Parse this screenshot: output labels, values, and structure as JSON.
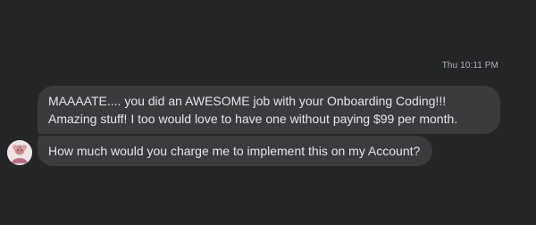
{
  "conversation": {
    "timestamp": "Thu 10:11 PM",
    "messages": [
      {
        "text": "MAAAATE.... you did an AWESOME job with your Onboarding Coding!!! Amazing stuff! I too would love to have one without paying $99 per month."
      },
      {
        "text": "How much would you charge me to implement this on my Account?"
      }
    ],
    "sender_avatar": "profile-photo-icon"
  },
  "colors": {
    "background": "#242526",
    "bubble": "#3a3b3c",
    "text": "#e4e6eb",
    "timestamp": "#b0b3b8"
  }
}
